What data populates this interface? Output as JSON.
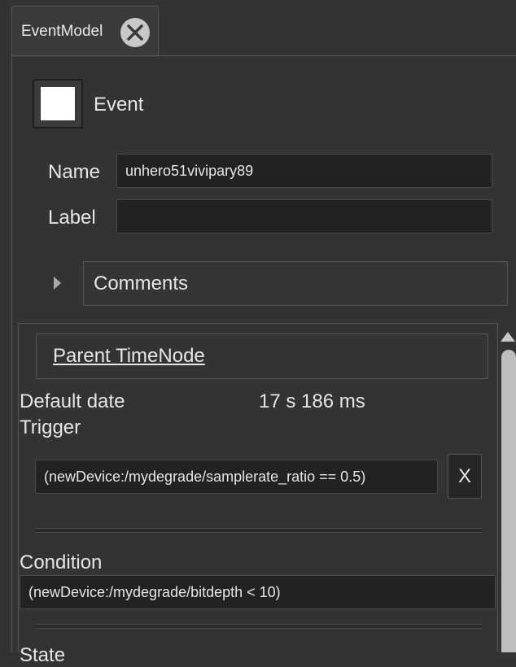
{
  "tab": {
    "label": "EventModel",
    "close_icon": "close-circle-icon"
  },
  "event": {
    "title": "Event",
    "swatch_color": "#ffffff"
  },
  "name": {
    "label": "Name",
    "value": "unhero51vivipary89"
  },
  "label_field": {
    "label": "Label",
    "value": ""
  },
  "comments": {
    "label": "Comments",
    "expand_icon": "caret-right-icon"
  },
  "parent": {
    "label": "Parent TimeNode"
  },
  "default_date": {
    "label": "Default date",
    "value": "17 s 186 ms"
  },
  "trigger": {
    "label": "Trigger",
    "expression": "(newDevice:/mydegrade/samplerate_ratio == 0.5)",
    "clear_label": "X"
  },
  "condition": {
    "label": "Condition",
    "expression": "(newDevice:/mydegrade/bitdepth < 10)"
  },
  "next_section": {
    "label": "State"
  }
}
